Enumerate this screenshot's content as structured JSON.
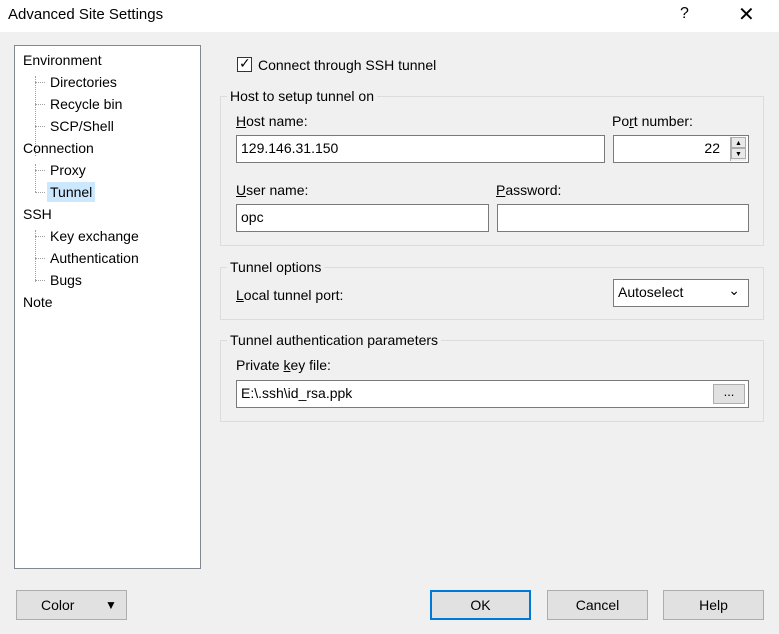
{
  "window": {
    "title": "Advanced Site Settings",
    "help_glyph": "?",
    "close_glyph": "✕"
  },
  "tree": {
    "items": [
      {
        "label": "Environment",
        "level": 0
      },
      {
        "label": "Directories",
        "level": 1
      },
      {
        "label": "Recycle bin",
        "level": 1
      },
      {
        "label": "SCP/Shell",
        "level": 1
      },
      {
        "label": "Connection",
        "level": 0
      },
      {
        "label": "Proxy",
        "level": 1
      },
      {
        "label": "Tunnel",
        "level": 1,
        "selected": true
      },
      {
        "label": "SSH",
        "level": 0
      },
      {
        "label": "Key exchange",
        "level": 1
      },
      {
        "label": "Authentication",
        "level": 1
      },
      {
        "label": "Bugs",
        "level": 1
      },
      {
        "label": "Note",
        "level": 0
      }
    ]
  },
  "ssh_tunnel": {
    "checkbox_label": "Connect through SSH tunnel",
    "checked": true
  },
  "host_group": {
    "title": "Host to setup tunnel on",
    "host_label_u": "H",
    "host_label_rest": "ost name:",
    "host_value": "129.146.31.150",
    "port_label_pre": "Po",
    "port_label_u": "r",
    "port_label_rest": "t number:",
    "port_value": "22",
    "user_label_u": "U",
    "user_label_rest": "ser name:",
    "user_value": "opc",
    "password_label_u": "P",
    "password_label_rest": "assword:",
    "password_value": ""
  },
  "tunnel_options": {
    "title": "Tunnel options",
    "local_port_label_u": "L",
    "local_port_label_rest": "ocal tunnel port:",
    "local_port_value": "Autoselect"
  },
  "tunnel_auth": {
    "title": "Tunnel authentication parameters",
    "key_label_pre": "Private ",
    "key_label_u": "k",
    "key_label_rest": "ey file:",
    "key_value": "E:\\.ssh\\id_rsa.ppk",
    "browse_label": "..."
  },
  "footer": {
    "color_label": "Color",
    "color_arrow": "▼",
    "ok_label": "OK",
    "cancel_label": "Cancel",
    "help_label": "Help"
  }
}
